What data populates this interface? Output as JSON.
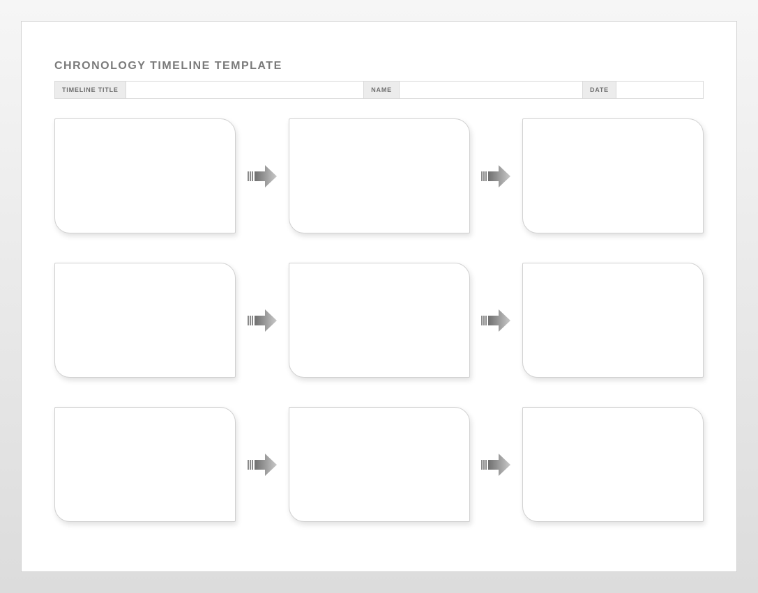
{
  "title": "CHRONOLOGY TIMELINE TEMPLATE",
  "header": {
    "timeline_title_label": "TIMELINE TITLE",
    "timeline_title_value": "",
    "name_label": "NAME",
    "name_value": "",
    "date_label": "DATE",
    "date_value": ""
  },
  "rows": [
    {
      "cells": [
        "",
        "",
        ""
      ]
    },
    {
      "cells": [
        "",
        "",
        ""
      ]
    },
    {
      "cells": [
        "",
        "",
        ""
      ]
    }
  ]
}
